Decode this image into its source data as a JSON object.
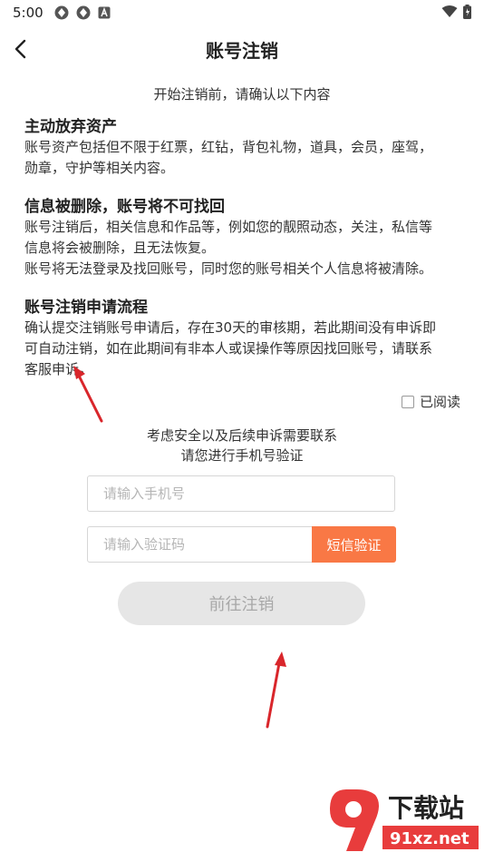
{
  "status_bar": {
    "time": "5:00"
  },
  "header": {
    "title": "账号注销"
  },
  "intro": "开始注销前，请确认以下内容",
  "sections": [
    {
      "title": "主动放弃资产",
      "lines": [
        "账号资产包括但不限于红票，红钻，背包礼物，道具，会员，座驾，",
        "勋章，守护等相关内容。"
      ]
    },
    {
      "title": "信息被删除，账号将不可找回",
      "lines": [
        "账号注销后，相关信息和作品等，例如您的靓照动态，关注，私信等",
        "信息将会被删除，且无法恢复。",
        "账号将无法登录及找回账号，同时您的账号相关个人信息将被清除。"
      ]
    },
    {
      "title": "账号注销申请流程",
      "lines": [
        "确认提交注销账号申请后，存在30天的审核期，若此期间没有申诉即",
        "可自动注销，如在此期间有非本人或误操作等原因找回账号，请联系",
        "客服申诉。"
      ]
    }
  ],
  "read_label": "已阅读",
  "notice": [
    "考虑安全以及后续申诉需要联系",
    "请您进行手机号验证"
  ],
  "phone_input": {
    "placeholder": "请输入手机号",
    "value": ""
  },
  "code_input": {
    "placeholder": "请输入验证码",
    "value": ""
  },
  "sms_button": "短信验证",
  "submit_button": "前往注销",
  "watermark": {
    "brand": "下载站",
    "domain": "91xz.net"
  },
  "colors": {
    "accent": "#f97845",
    "disabled_bg": "#e6e6e6",
    "disabled_text": "#a8a8a8",
    "arrow": "#d9262b"
  }
}
